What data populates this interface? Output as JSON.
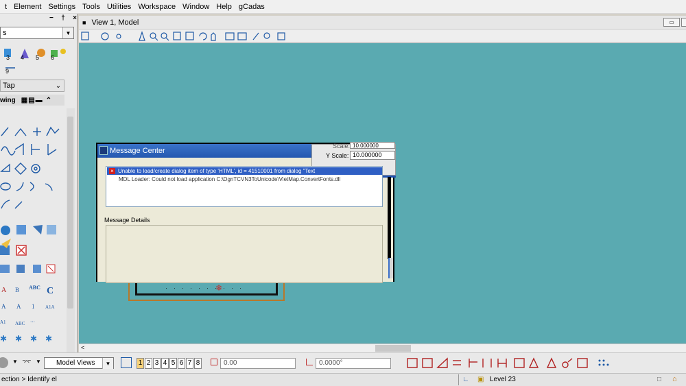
{
  "menu": {
    "items": [
      "t",
      "Element",
      "Settings",
      "Tools",
      "Utilities",
      "Workspace",
      "Window",
      "Help",
      "gCadas"
    ]
  },
  "left_panel": {
    "panel_controls": [
      "−",
      "†",
      "×"
    ],
    "combo_text": "s",
    "tap_label": "Tap",
    "section_label": "wing"
  },
  "view": {
    "title": "View 1, Model"
  },
  "dialog": {
    "title": "Message Center",
    "messages": [
      "Unable to load/create dialog item of type 'HTML', id = 41510001 from dialog \"Text",
      "MDL Loader: Could not load application C:\\DgnTCVN3ToUnicode\\VietMap.ConvertFonts.dll"
    ],
    "details_label": "Message Details",
    "scale_partial": "Scale:",
    "y_scale_label": "Y Scale:",
    "y_scale_value": "10.000000",
    "partial_value": "10.000000"
  },
  "bottom_toolbar": {
    "model_views_label": "Model Views",
    "view_numbers": [
      "1",
      "2",
      "3",
      "4",
      "5",
      "6",
      "7",
      "8"
    ],
    "distance_value": "0.00",
    "angle_value": "0.0000°"
  },
  "status": {
    "left_text": "ection > Identify el",
    "level": "Level 23"
  },
  "colors": {
    "canvas": "#5aaab1",
    "dialog_title": "#2d63bd",
    "selection": "#2f5fc4"
  }
}
